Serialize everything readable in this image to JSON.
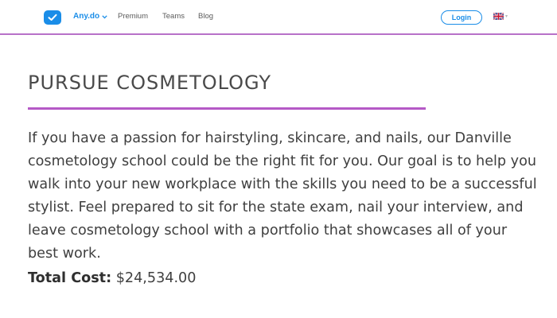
{
  "nav": {
    "brand_label": "Any.do",
    "links": [
      "Premium",
      "Teams",
      "Blog"
    ],
    "login_label": "Login",
    "logo_icon": "checkmark-icon",
    "language_icon": "uk-flag-icon"
  },
  "colors": {
    "accent_blue": "#1a8de8",
    "accent_purple": "#b559c6",
    "text": "#3f3f3f"
  },
  "content": {
    "title": "PURSUE COSMETOLOGY",
    "body": "If you have a passion for hairstyling, skincare, and nails, our Danville cosmetology school could be the right fit for you. Our goal is to help you walk into your new workplace with the skills you need to be a successful stylist. Feel prepared to sit for the state exam, nail your interview, and leave cosmetology school with a portfolio that showcases all of your best work.",
    "cost_label": "Total Cost:",
    "cost_value": "$24,534.00"
  }
}
